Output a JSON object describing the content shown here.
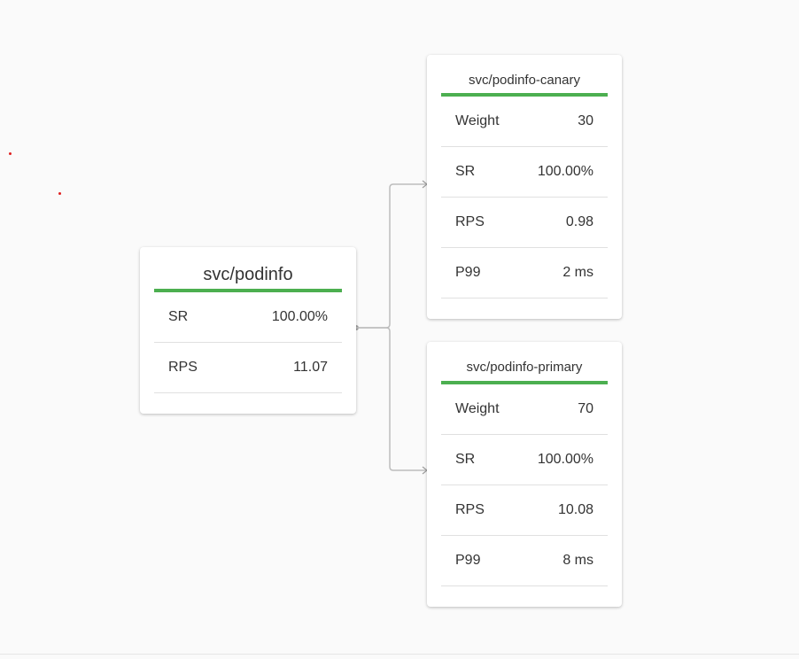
{
  "root": {
    "title": "svc/podinfo",
    "metrics": [
      {
        "label": "SR",
        "value": "100.00%"
      },
      {
        "label": "RPS",
        "value": "11.07"
      }
    ]
  },
  "canary": {
    "title": "svc/podinfo-canary",
    "metrics": [
      {
        "label": "Weight",
        "value": "30"
      },
      {
        "label": "SR",
        "value": "100.00%"
      },
      {
        "label": "RPS",
        "value": "0.98"
      },
      {
        "label": "P99",
        "value": "2 ms"
      }
    ]
  },
  "primary": {
    "title": "svc/podinfo-primary",
    "metrics": [
      {
        "label": "Weight",
        "value": "70"
      },
      {
        "label": "SR",
        "value": "100.00%"
      },
      {
        "label": "RPS",
        "value": "10.08"
      },
      {
        "label": "P99",
        "value": "8 ms"
      }
    ]
  },
  "colors": {
    "status_bar": "#4caf50",
    "edge": "#bdbdbd",
    "marker": "#e02020"
  }
}
